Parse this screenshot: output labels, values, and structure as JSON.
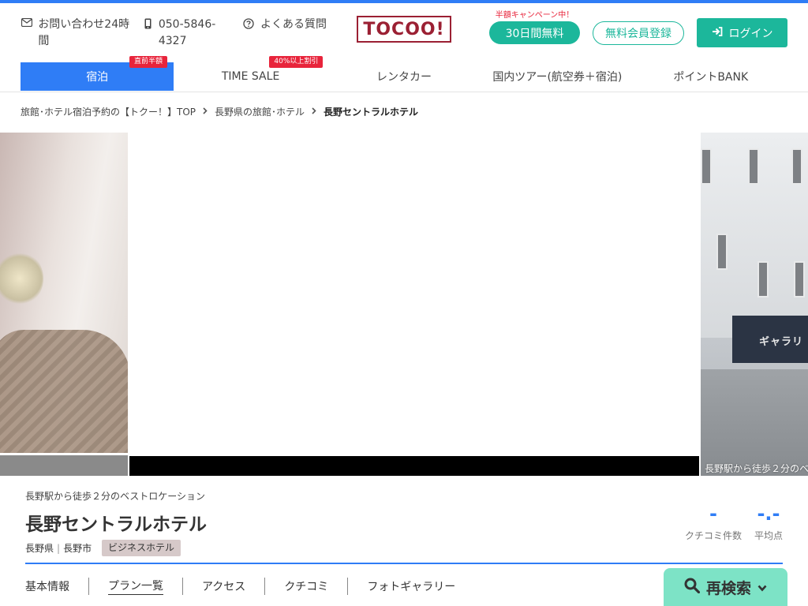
{
  "header": {
    "contact": "お問い合わせ24時間",
    "phone": "050-5846-4327",
    "faq": "よくある質問",
    "logo": "TOCOO!",
    "campaign_note": "半額キャンペーン中！",
    "trial_button": "30日間無料",
    "register_button": "無料会員登録",
    "login_button": "ログイン"
  },
  "nav": {
    "tabs": [
      {
        "label": "宿泊",
        "badge": "直前半額"
      },
      {
        "label": "TIME SALE",
        "badge": "40%以上割引"
      },
      {
        "label": "レンタカー"
      },
      {
        "label": "国内ツアー(航空券＋宿泊)"
      },
      {
        "label": "ポイントBANK"
      }
    ]
  },
  "breadcrumb": {
    "items": [
      "旅館･ホテル宿泊予約の【トクー！】TOP",
      "長野県の旅館･ホテル"
    ],
    "current": "長野セントラルホテル"
  },
  "gallery": {
    "right_sign": "ギャラリ",
    "caption": "長野駅から徒歩２分のベ"
  },
  "hotel": {
    "catch": "長野駅から徒歩２分のベストロケーション",
    "name": "長野セントラルホテル",
    "prefecture": "長野県",
    "city": "長野市",
    "category": "ビジネスホテル",
    "review_count": "-",
    "review_count_label": "クチコミ件数",
    "average": "-.-",
    "average_label": "平均点"
  },
  "subtabs": [
    "基本情報",
    "プラン一覧",
    "アクセス",
    "クチコミ",
    "フォトギャラリー"
  ],
  "research_button": "再検索",
  "colors": {
    "accent": "#2f7df6",
    "brand": "#9b2033",
    "green": "#1cb79b",
    "badge_red": "#e8243b"
  }
}
